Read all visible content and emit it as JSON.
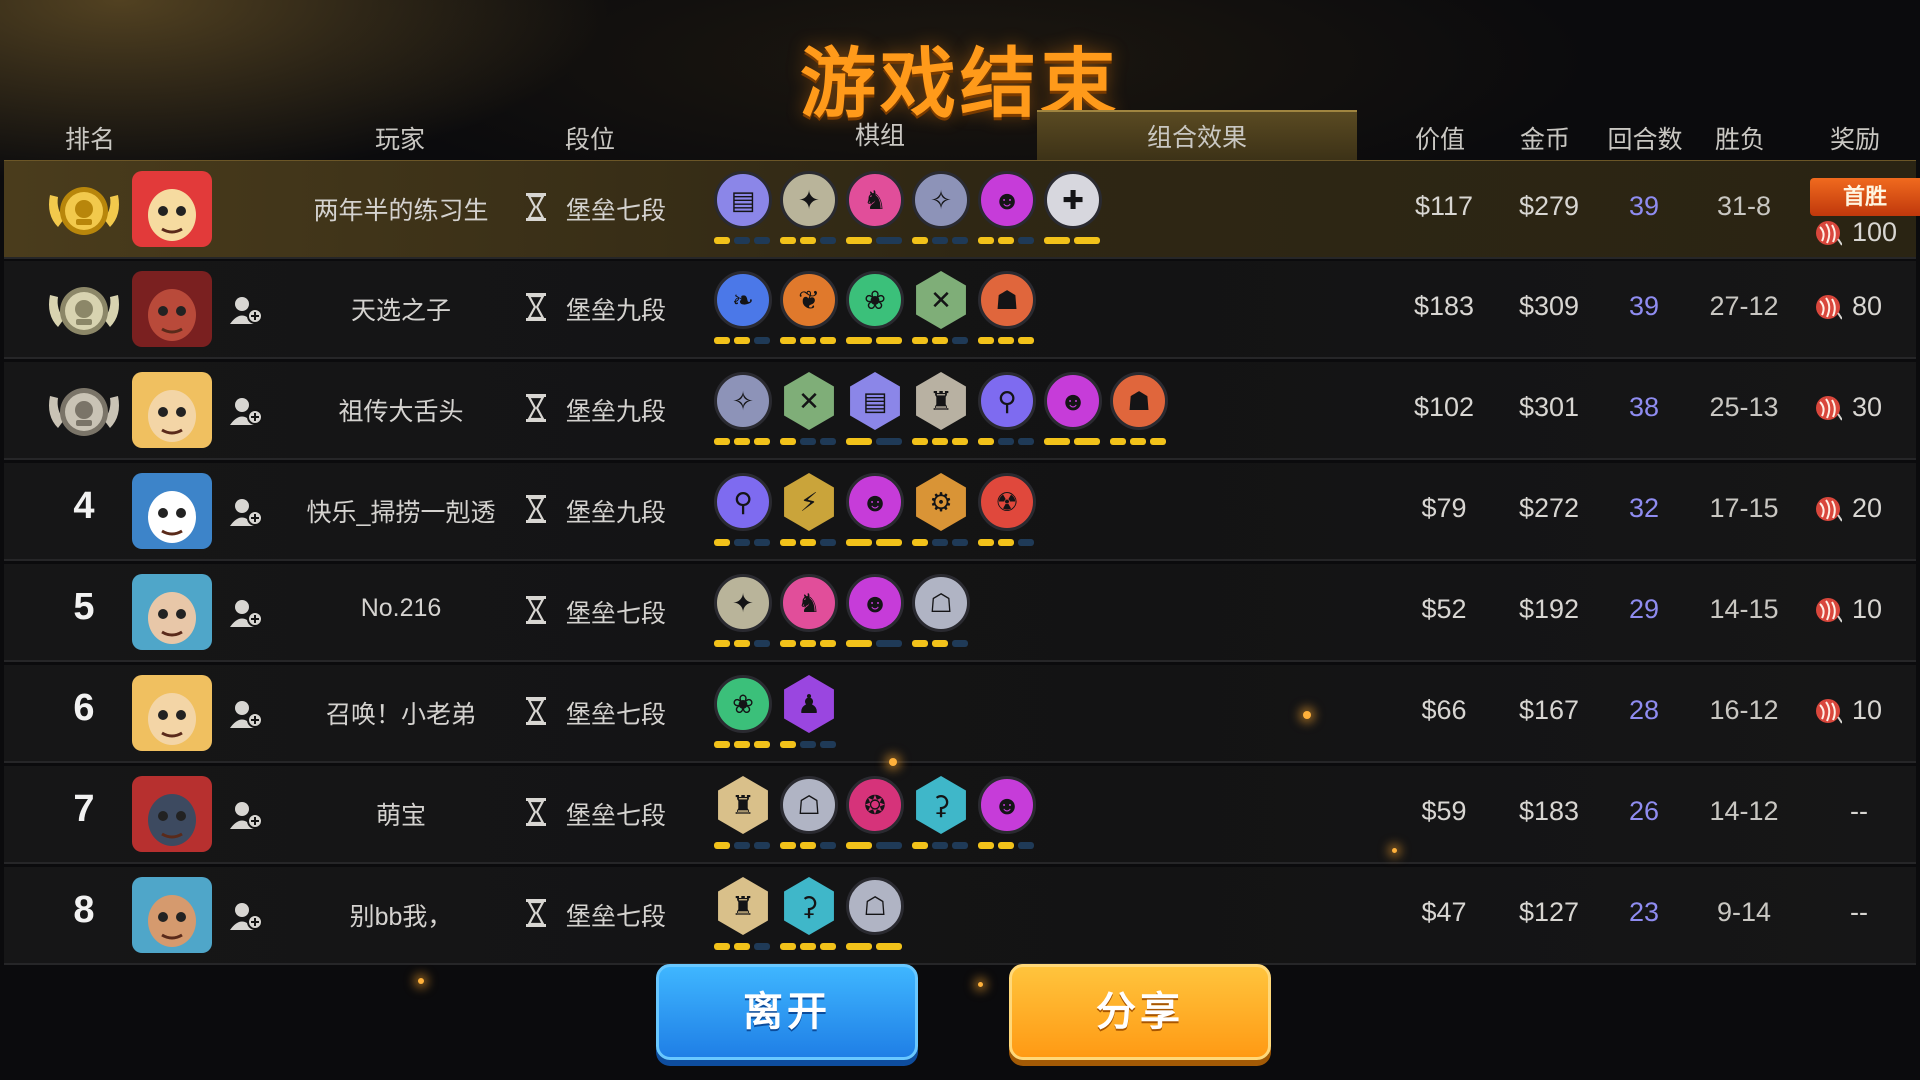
{
  "title": "游戏结束",
  "headers": {
    "rank": "排名",
    "player": "玩家",
    "tier": "段位",
    "lineup": "棋组",
    "combo": "组合效果",
    "value": "价值",
    "gold": "金币",
    "rounds": "回合数",
    "win_loss": "胜负",
    "reward": "奖励"
  },
  "first_win_badge": "首胜",
  "players": [
    {
      "rank": "",
      "name": "两年半的练习生",
      "tier": "堡垒七段",
      "value": "$117",
      "gold": "$279",
      "rounds": "39",
      "win_loss": "31-8",
      "reward": "100"
    },
    {
      "rank": "",
      "name": "天选之子",
      "tier": "堡垒九段",
      "value": "$183",
      "gold": "$309",
      "rounds": "39",
      "win_loss": "27-12",
      "reward": "80"
    },
    {
      "rank": "",
      "name": "祖传大舌头",
      "tier": "堡垒九段",
      "value": "$102",
      "gold": "$301",
      "rounds": "38",
      "win_loss": "25-13",
      "reward": "30"
    },
    {
      "rank": "4",
      "name": "快乐_掃捞一剋透",
      "tier": "堡垒九段",
      "value": "$79",
      "gold": "$272",
      "rounds": "32",
      "win_loss": "17-15",
      "reward": "20"
    },
    {
      "rank": "5",
      "name": "No.216",
      "tier": "堡垒七段",
      "value": "$52",
      "gold": "$192",
      "rounds": "29",
      "win_loss": "14-15",
      "reward": "10"
    },
    {
      "rank": "6",
      "name": "召唤！小老弟",
      "tier": "堡垒七段",
      "value": "$66",
      "gold": "$167",
      "rounds": "28",
      "win_loss": "16-12",
      "reward": "10"
    },
    {
      "rank": "7",
      "name": "萌宝",
      "tier": "堡垒七段",
      "value": "$59",
      "gold": "$183",
      "rounds": "26",
      "win_loss": "14-12",
      "reward": "--"
    },
    {
      "rank": "8",
      "name": "别bb我，",
      "tier": "堡垒七段",
      "value": "$47",
      "gold": "$127",
      "rounds": "23",
      "win_loss": "9-14",
      "reward": "--"
    }
  ],
  "synergies": [
    [
      [
        "#8b86e8",
        "circle",
        "▤"
      ],
      [
        "#b9b49a",
        "circle",
        "✦"
      ],
      [
        "#e14e9a",
        "circle",
        "♞"
      ],
      [
        "#8d93b8",
        "circle",
        "✧"
      ],
      [
        "#c63cd9",
        "circle",
        "☻"
      ],
      [
        "#d7d7de",
        "circle",
        "✚"
      ]
    ],
    [
      [
        "#4b78e8",
        "circle",
        "❧"
      ],
      [
        "#e0792c",
        "circle",
        "❦"
      ],
      [
        "#3bc07a",
        "circle",
        "❀"
      ],
      [
        "#7fae78",
        "hex",
        "✕"
      ],
      [
        "#e0663c",
        "circle",
        "☗"
      ]
    ],
    [
      [
        "#8d93b8",
        "circle",
        "✧"
      ],
      [
        "#7fae78",
        "hex",
        "✕"
      ],
      [
        "#8b86e8",
        "hex",
        "▤"
      ],
      [
        "#b8b1a2",
        "hex",
        "♜"
      ],
      [
        "#7e6bf0",
        "circle",
        "⚲"
      ],
      [
        "#c63cd9",
        "circle",
        "☻"
      ],
      [
        "#e0663c",
        "circle",
        "☗"
      ]
    ],
    [
      [
        "#7e6bf0",
        "circle",
        "⚲"
      ],
      [
        "#caa43a",
        "hex",
        "⚡"
      ],
      [
        "#c63cd9",
        "circle",
        "☻"
      ],
      [
        "#d99436",
        "hex",
        "⚙"
      ],
      [
        "#e0483c",
        "circle",
        "☢"
      ]
    ],
    [
      [
        "#b9b49a",
        "circle",
        "✦"
      ],
      [
        "#e14e9a",
        "circle",
        "♞"
      ],
      [
        "#c63cd9",
        "circle",
        "☻"
      ],
      [
        "#b0b4c4",
        "circle",
        "☖"
      ]
    ],
    [
      [
        "#3bc07a",
        "circle",
        "❀"
      ],
      [
        "#9a46e0",
        "hex",
        "♟"
      ]
    ],
    [
      [
        "#d9c08a",
        "hex",
        "♜"
      ],
      [
        "#b0b4c4",
        "circle",
        "☖"
      ],
      [
        "#d6337a",
        "circle",
        "❂"
      ],
      [
        "#3fb7c9",
        "hex",
        "⚳"
      ],
      [
        "#c63cd9",
        "circle",
        "☻"
      ]
    ],
    [
      [
        "#d9c08a",
        "hex",
        "♜"
      ],
      [
        "#3fb7c9",
        "hex",
        "⚳"
      ],
      [
        "#b0b4c4",
        "circle",
        "☖"
      ]
    ]
  ],
  "buttons": {
    "leave": "离开",
    "share": "分享"
  },
  "colors": {
    "title": "#ff9a1a",
    "rounds": "#8f8cf0",
    "bar_active": "#f2c21a",
    "bar_inactive": "#1f3a57"
  }
}
